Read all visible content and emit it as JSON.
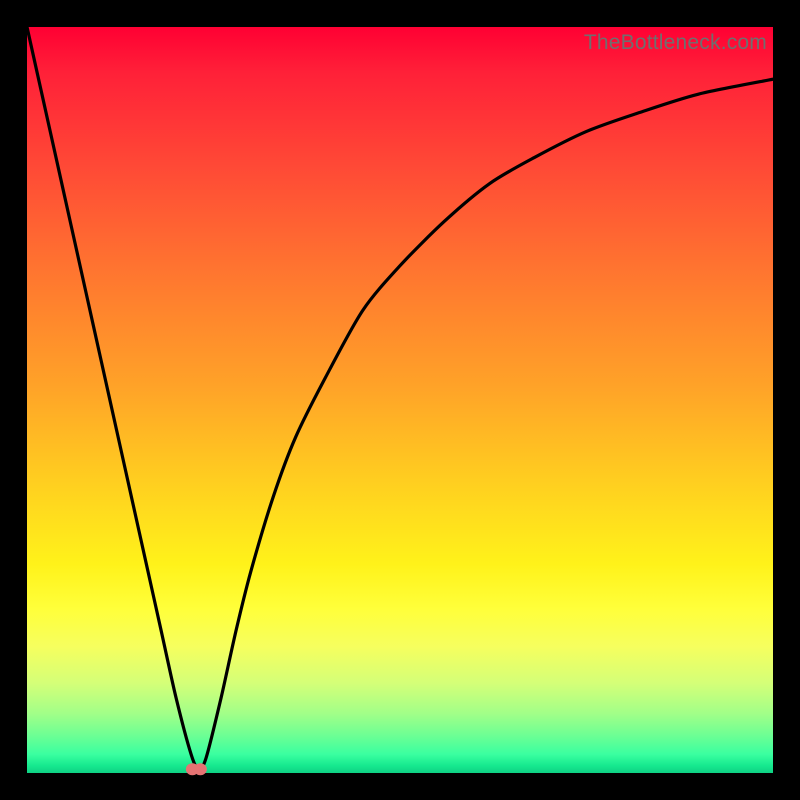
{
  "watermark": "TheBottleneck.com",
  "colors": {
    "frame": "#000000",
    "gradient_top": "#ff0033",
    "gradient_bottom": "#0fd184",
    "curve": "#000000",
    "marker": "#e57373"
  },
  "chart_data": {
    "type": "line",
    "title": "",
    "xlabel": "",
    "ylabel": "",
    "xlim": [
      0,
      100
    ],
    "ylim": [
      0,
      100
    ],
    "series": [
      {
        "name": "bottleneck-curve",
        "x": [
          0,
          2,
          4,
          6,
          8,
          10,
          12,
          14,
          16,
          18,
          20,
          22,
          23,
          24,
          26,
          28,
          30,
          33,
          36,
          40,
          45,
          50,
          56,
          62,
          68,
          75,
          82,
          90,
          100
        ],
        "values": [
          100,
          91,
          82,
          73,
          64,
          55,
          46,
          37,
          28,
          19,
          10,
          2.5,
          0.5,
          2,
          10,
          19,
          27,
          37,
          45,
          53,
          62,
          68,
          74,
          79,
          82.5,
          86,
          88.5,
          91,
          93
        ]
      }
    ],
    "markers": [
      {
        "name": "optimum-point",
        "x": 22.7,
        "y": 0.5
      }
    ],
    "grid": false,
    "legend": false
  }
}
